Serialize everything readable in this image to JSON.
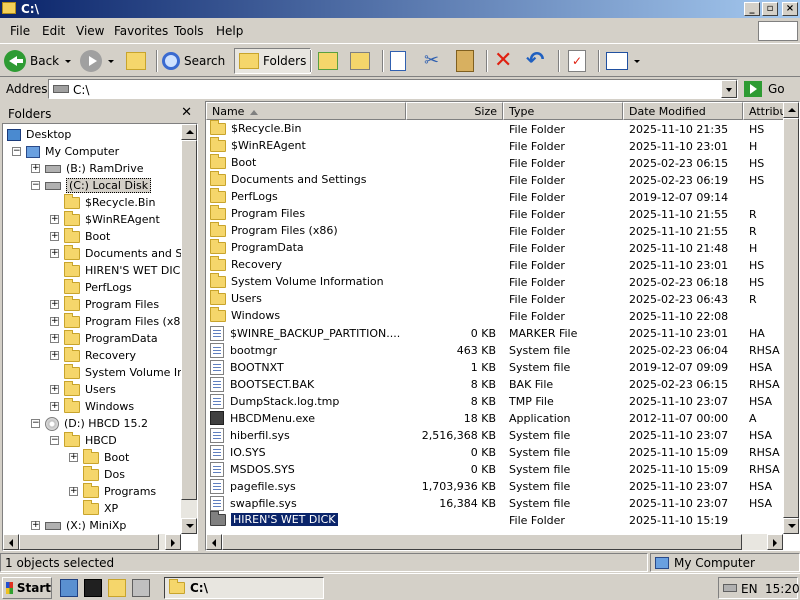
{
  "window": {
    "title": "C:\\"
  },
  "menu": [
    "File",
    "Edit",
    "View",
    "Favorites",
    "Tools",
    "Help"
  ],
  "toolbar": {
    "back": "Back",
    "search": "Search",
    "folders": "Folders"
  },
  "address": {
    "label": "Address",
    "value": "C:\\",
    "go": "Go"
  },
  "folders_pane": {
    "title": "Folders",
    "close": "✕",
    "tree": [
      {
        "label": "Desktop",
        "icon": "desktop-icon"
      },
      {
        "label": "My Computer",
        "icon": "computer-icon",
        "toggle": "−"
      },
      {
        "label": "(B:) RamDrive",
        "icon": "drive-icon",
        "toggle": "+"
      },
      {
        "label": "(C:) Local Disk",
        "icon": "drive-icon",
        "toggle": "−",
        "selected": true
      },
      {
        "label": "$Recycle.Bin",
        "icon": "folder-icon"
      },
      {
        "label": "$WinREAgent",
        "icon": "folder-icon",
        "toggle": "+"
      },
      {
        "label": "Boot",
        "icon": "folder-icon",
        "toggle": "+"
      },
      {
        "label": "Documents and Setti",
        "icon": "folder-icon",
        "toggle": "+"
      },
      {
        "label": "HIREN'S WET DICK",
        "icon": "folder-icon"
      },
      {
        "label": "PerfLogs",
        "icon": "folder-icon"
      },
      {
        "label": "Program Files",
        "icon": "folder-icon",
        "toggle": "+"
      },
      {
        "label": "Program Files (x86)",
        "icon": "folder-icon",
        "toggle": "+"
      },
      {
        "label": "ProgramData",
        "icon": "folder-icon",
        "toggle": "+"
      },
      {
        "label": "Recovery",
        "icon": "folder-icon",
        "toggle": "+"
      },
      {
        "label": "System Volume Inforr",
        "icon": "folder-icon"
      },
      {
        "label": "Users",
        "icon": "folder-icon",
        "toggle": "+"
      },
      {
        "label": "Windows",
        "icon": "folder-icon",
        "toggle": "+"
      },
      {
        "label": "(D:) HBCD 15.2",
        "icon": "cd-icon",
        "toggle": "−"
      },
      {
        "label": "HBCD",
        "icon": "folder-icon",
        "toggle": "−"
      },
      {
        "label": "Boot",
        "icon": "folder-icon",
        "toggle": "+"
      },
      {
        "label": "Dos",
        "icon": "folder-icon"
      },
      {
        "label": "Programs",
        "icon": "folder-icon",
        "toggle": "+"
      },
      {
        "label": "XP",
        "icon": "folder-icon"
      },
      {
        "label": "(X:) MiniXp",
        "icon": "drive-icon",
        "toggle": "+"
      }
    ]
  },
  "columns": {
    "name": "Name",
    "size": "Size",
    "type": "Type",
    "date": "Date Modified",
    "attr": "Attributes"
  },
  "files": [
    {
      "name": "$Recycle.Bin",
      "size": "",
      "type": "File Folder",
      "date": "2025-11-10 21:35",
      "attr": "HS",
      "icon": "folder-icon"
    },
    {
      "name": "$WinREAgent",
      "size": "",
      "type": "File Folder",
      "date": "2025-11-10 23:01",
      "attr": "H",
      "icon": "folder-icon"
    },
    {
      "name": "Boot",
      "size": "",
      "type": "File Folder",
      "date": "2025-02-23 06:15",
      "attr": "HS",
      "icon": "folder-icon"
    },
    {
      "name": "Documents and Settings",
      "size": "",
      "type": "File Folder",
      "date": "2025-02-23 06:19",
      "attr": "HS",
      "icon": "folder-icon"
    },
    {
      "name": "PerfLogs",
      "size": "",
      "type": "File Folder",
      "date": "2019-12-07 09:14",
      "attr": "",
      "icon": "folder-icon"
    },
    {
      "name": "Program Files",
      "size": "",
      "type": "File Folder",
      "date": "2025-11-10 21:55",
      "attr": "R",
      "icon": "folder-icon"
    },
    {
      "name": "Program Files (x86)",
      "size": "",
      "type": "File Folder",
      "date": "2025-11-10 21:55",
      "attr": "R",
      "icon": "folder-icon"
    },
    {
      "name": "ProgramData",
      "size": "",
      "type": "File Folder",
      "date": "2025-11-10 21:48",
      "attr": "H",
      "icon": "folder-icon"
    },
    {
      "name": "Recovery",
      "size": "",
      "type": "File Folder",
      "date": "2025-11-10 23:01",
      "attr": "HS",
      "icon": "folder-icon"
    },
    {
      "name": "System Volume Information",
      "size": "",
      "type": "File Folder",
      "date": "2025-02-23 06:18",
      "attr": "HS",
      "icon": "folder-icon"
    },
    {
      "name": "Users",
      "size": "",
      "type": "File Folder",
      "date": "2025-02-23 06:43",
      "attr": "R",
      "icon": "folder-icon"
    },
    {
      "name": "Windows",
      "size": "",
      "type": "File Folder",
      "date": "2025-11-10 22:08",
      "attr": "",
      "icon": "folder-icon"
    },
    {
      "name": "$WINRE_BACKUP_PARTITION....",
      "size": "0 KB",
      "type": "MARKER File",
      "date": "2025-11-10 23:01",
      "attr": "HA",
      "icon": "file-icon"
    },
    {
      "name": "bootmgr",
      "size": "463 KB",
      "type": "System file",
      "date": "2025-02-23 06:04",
      "attr": "RHSA",
      "icon": "file-icon"
    },
    {
      "name": "BOOTNXT",
      "size": "1 KB",
      "type": "System file",
      "date": "2019-12-07 09:09",
      "attr": "HSA",
      "icon": "file-icon"
    },
    {
      "name": "BOOTSECT.BAK",
      "size": "8 KB",
      "type": "BAK File",
      "date": "2025-02-23 06:15",
      "attr": "RHSA",
      "icon": "file-icon"
    },
    {
      "name": "DumpStack.log.tmp",
      "size": "8 KB",
      "type": "TMP File",
      "date": "2025-11-10 23:07",
      "attr": "HSA",
      "icon": "file-icon"
    },
    {
      "name": "HBCDMenu.exe",
      "size": "18 KB",
      "type": "Application",
      "date": "2012-11-07 00:00",
      "attr": "A",
      "icon": "app-icon"
    },
    {
      "name": "hiberfil.sys",
      "size": "2,516,368 KB",
      "type": "System file",
      "date": "2025-11-10 23:07",
      "attr": "HSA",
      "icon": "file-icon"
    },
    {
      "name": "IO.SYS",
      "size": "0 KB",
      "type": "System file",
      "date": "2025-11-10 15:09",
      "attr": "RHSA",
      "icon": "file-icon"
    },
    {
      "name": "MSDOS.SYS",
      "size": "0 KB",
      "type": "System file",
      "date": "2025-11-10 15:09",
      "attr": "RHSA",
      "icon": "file-icon"
    },
    {
      "name": "pagefile.sys",
      "size": "1,703,936 KB",
      "type": "System file",
      "date": "2025-11-10 23:07",
      "attr": "HSA",
      "icon": "file-icon"
    },
    {
      "name": "swapfile.sys",
      "size": "16,384 KB",
      "type": "System file",
      "date": "2025-11-10 23:07",
      "attr": "HSA",
      "icon": "file-icon"
    },
    {
      "name": "HIREN'S WET DICK",
      "size": "",
      "type": "File Folder",
      "date": "2025-11-10 15:19",
      "attr": "",
      "icon": "folder-dark-icon",
      "selected": true
    }
  ],
  "status": {
    "left": "1 objects selected",
    "right": "My Computer"
  },
  "taskbar": {
    "start": "Start",
    "window": "C:\\",
    "lang": "EN",
    "time": "15:20"
  }
}
